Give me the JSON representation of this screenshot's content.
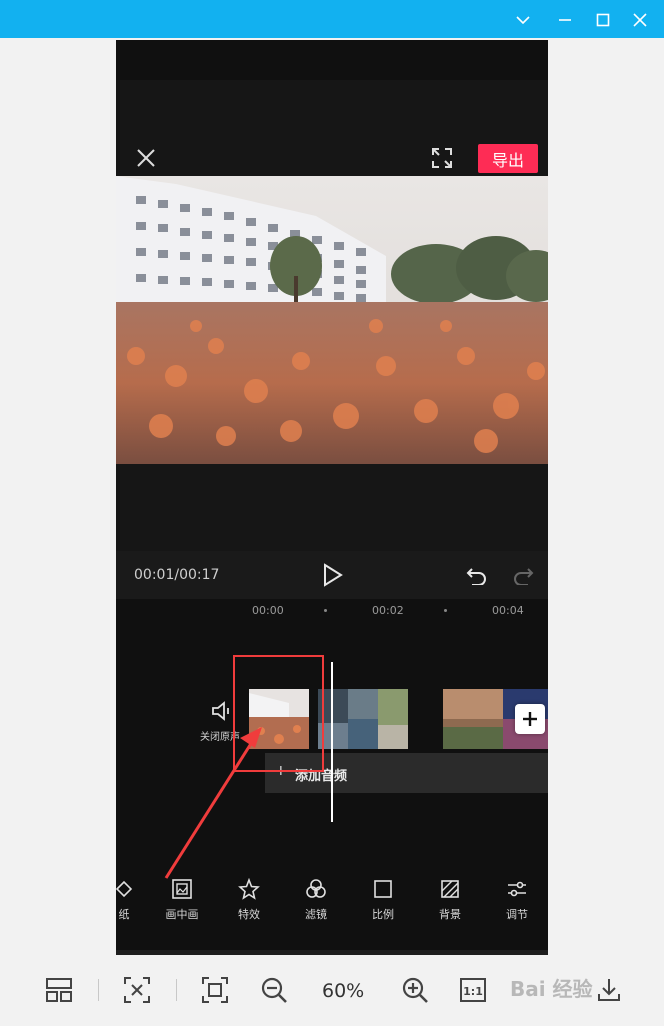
{
  "window": {
    "buttons": [
      "minimize-dropdown",
      "minimize",
      "maximize",
      "close"
    ]
  },
  "editor": {
    "export_label": "导出",
    "timecode": "00:01/00:17",
    "ruler": [
      "00:00",
      "00:02",
      "00:04"
    ],
    "mute_label": "关闭原声",
    "add_audio_label": "添加音频",
    "add_audio_plus": "+",
    "tools": [
      "纸",
      "画中画",
      "特效",
      "滤镜",
      "比例",
      "背景",
      "调节"
    ]
  },
  "viewer": {
    "zoom": "60%",
    "watermark": "Bai 经验"
  },
  "colors": {
    "titlebar": "#12b1f0",
    "export": "#fe2c55",
    "annotation": "#f03c3c"
  }
}
